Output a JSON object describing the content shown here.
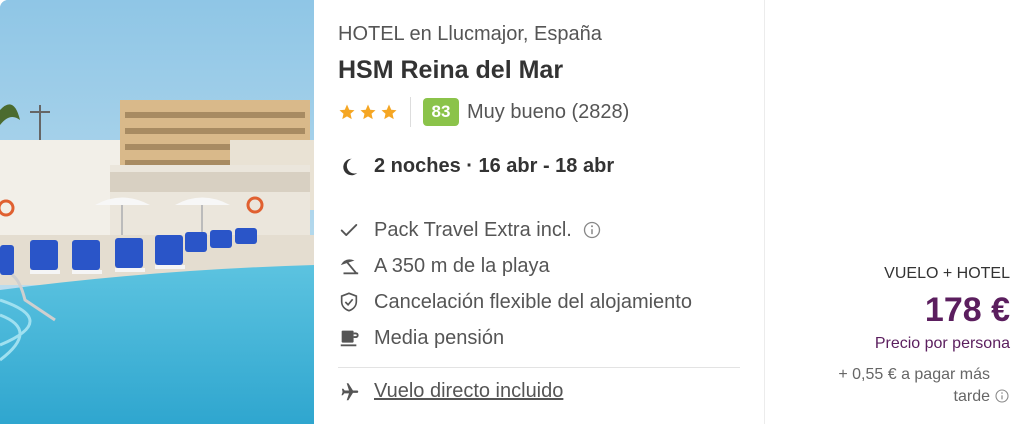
{
  "hotel": {
    "category": "HOTEL en Llucmajor, España",
    "name": "HSM Reina del Mar",
    "stars": 3,
    "score": "83",
    "review_text": "Muy bueno (2828)"
  },
  "stay": {
    "dates": "2 noches · 16 abr - 18 abr"
  },
  "features": [
    {
      "icon": "check-icon",
      "text": "Pack Travel Extra incl."
    },
    {
      "icon": "beach-umbrella-icon",
      "text": "A 350 m de la playa"
    },
    {
      "icon": "shield-check-icon",
      "text": "Cancelación flexible del alojamiento"
    },
    {
      "icon": "coffee-cup-icon",
      "text": "Media pensión"
    }
  ],
  "flight": {
    "text": "Vuelo directo incluido"
  },
  "pricing": {
    "package_type": "VUELO + HOTEL",
    "price": "178 €",
    "per_person": "Precio por persona",
    "later_fee": "+ 0,55 € a pagar más tarde"
  },
  "colors": {
    "price": "#5b1e5e",
    "score_badge": "#8bc34a",
    "star": "#f5a623"
  }
}
